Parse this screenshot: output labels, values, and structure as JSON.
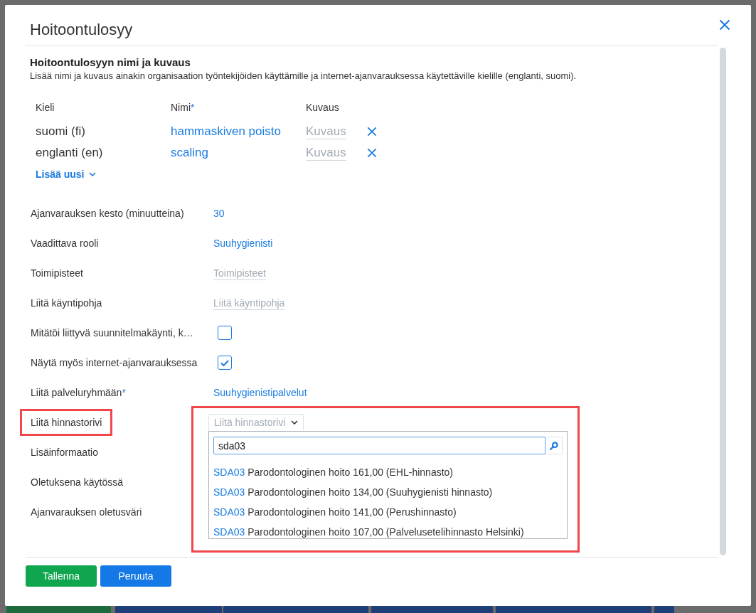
{
  "dialog": {
    "title": "Hoitoontulosyy"
  },
  "names_section": {
    "heading": "Hoitoontulosyyn nimi ja kuvaus",
    "description": "Lisää nimi ja kuvaus ainakin organisaation työntekijöiden käyttämille ja internet-ajanvarauksessa käytettäville kielille (englanti, suomi).",
    "columns": [
      {
        "label": "Kieli"
      },
      {
        "label": "Nimi",
        "required_mark": "*"
      },
      {
        "label": "Kuvaus"
      }
    ],
    "rows": [
      {
        "language": "suomi (fi)",
        "name": "hammaskiven poisto",
        "description_placeholder": "Kuvaus"
      },
      {
        "language": "englanti (en)",
        "name": "scaling",
        "description_placeholder": "Kuvaus"
      }
    ],
    "add_new": "Lisää uusi"
  },
  "fields": [
    {
      "label": "Ajanvarauksen kesto (minuutteina)",
      "kind": "value",
      "value": "30",
      "highlighted": false
    },
    {
      "label": "Vaadittava rooli",
      "kind": "value",
      "value": "Suuhygienisti",
      "highlighted": false
    },
    {
      "label": "Toimipisteet",
      "kind": "picker",
      "placeholder": "Toimipisteet",
      "highlighted": false
    },
    {
      "label": "Liitä käyntipohja",
      "kind": "picker",
      "placeholder": "Liitä käyntipohja",
      "highlighted": false
    },
    {
      "label": "Mitätöi liittyvä suunnitelmakäynti, k…",
      "kind": "checkbox",
      "checked": false,
      "highlighted": false
    },
    {
      "label": "Näytä myös internet-ajanvarauksessa",
      "kind": "checkbox",
      "checked": true,
      "highlighted": false
    },
    {
      "label": "Liitä palveluryhmään",
      "required_mark": "*",
      "kind": "value",
      "value": "Suuhygienistipalvelut",
      "highlighted": false
    },
    {
      "label": "Liitä hinnastorivi",
      "kind": "dropdown",
      "placeholder": "Liitä hinnastorivi",
      "expanded": true,
      "search_value": "sda03",
      "options": [
        {
          "code": "SDA03",
          "text": "Parodontologinen hoito 161,00 (EHL-hinnasto)"
        },
        {
          "code": "SDA03",
          "text": "Parodontologinen hoito 134,00 (Suuhygienisti hinnasto)"
        },
        {
          "code": "SDA03",
          "text": "Parodontologinen hoito 141,00 (Perushinnasto)"
        },
        {
          "code": "SDA03",
          "text": "Parodontologinen hoito 107,00 (Palvelusetelihinnasto Helsinki)"
        }
      ],
      "highlighted": true
    },
    {
      "label": "Lisäinformaatio",
      "kind": "covered",
      "highlighted": false
    },
    {
      "label": "Oletuksena käytössä",
      "kind": "covered",
      "highlighted": false
    },
    {
      "label": "Ajanvarauksen oletusväri",
      "kind": "covered",
      "highlighted": false
    }
  ],
  "footer": {
    "buttons": [
      {
        "label": "Tallenna",
        "kind": "success"
      },
      {
        "label": "Peruuta",
        "kind": "primary"
      }
    ]
  }
}
